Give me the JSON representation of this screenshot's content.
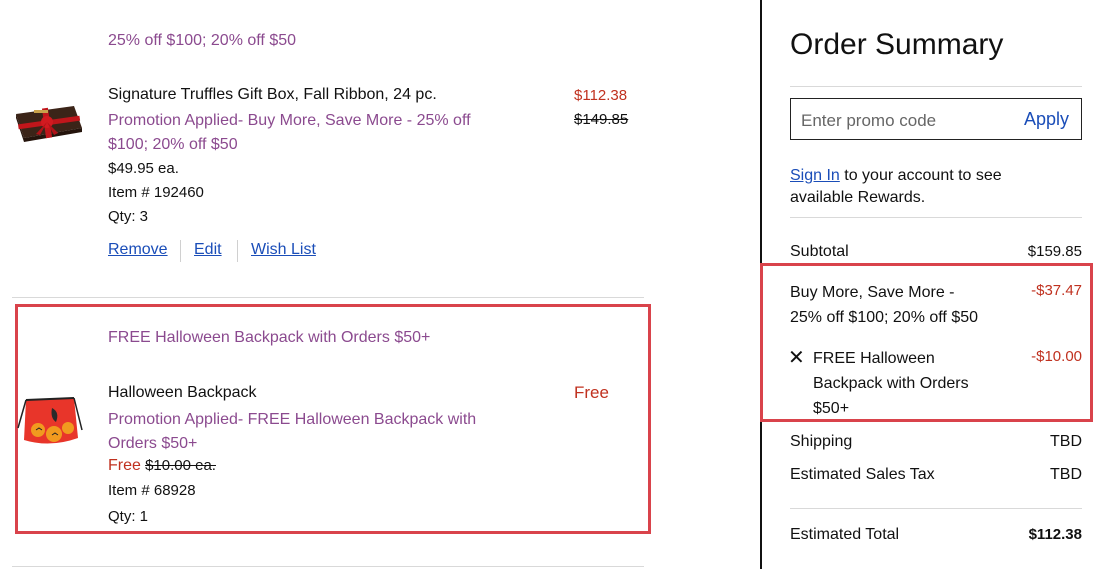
{
  "cart": {
    "top_promo_text": "25% off $100; 20% off $50",
    "item1": {
      "name": "Signature Truffles Gift Box, Fall Ribbon, 24 pc.",
      "promo_text": "Promotion Applied- Buy More, Save More - 25% off $100; 20% off $50",
      "price_each": "$49.95 ea.",
      "item_number": "Item # 192460",
      "qty": "Qty: 3",
      "price_sale": "$112.38",
      "price_original": "$149.85",
      "actions": {
        "remove": "Remove",
        "edit": "Edit",
        "wish_list": "Wish List"
      }
    },
    "item2": {
      "promo_header": "FREE Halloween Backpack with Orders $50+",
      "name": "Halloween Backpack",
      "promo_text": "Promotion Applied- FREE Halloween Backpack with Orders $50+",
      "price_free": "Free",
      "price_each_original": "$10.00 ea.",
      "item_number": "Item # 68928",
      "qty": "Qty: 1",
      "line_price": "Free"
    }
  },
  "summary": {
    "title": "Order Summary",
    "promo_placeholder": "Enter promo code",
    "apply_label": "Apply",
    "sign_in_link": "Sign In",
    "sign_in_rest": " to your account to see available Rewards.",
    "subtotal_label": "Subtotal",
    "subtotal_value": "$159.85",
    "discount1_label": "Buy More, Save More - 25% off $100; 20% off $50",
    "discount1_value": "-$37.47",
    "discount2_label": "FREE Halloween Backpack with Orders $50+",
    "discount2_value": "-$10.00",
    "shipping_label": "Shipping",
    "shipping_value": "TBD",
    "tax_label": "Estimated Sales Tax",
    "tax_value": "TBD",
    "total_label": "Estimated Total",
    "total_value": "$112.38"
  },
  "colors": {
    "promo_purple": "#8b4a8f",
    "price_red": "#c0311f",
    "link_blue": "#1a4db8",
    "highlight_red": "#d9434b"
  },
  "icons": [
    "truffle-box-thumbnail",
    "halloween-backpack-thumbnail",
    "close-icon"
  ]
}
